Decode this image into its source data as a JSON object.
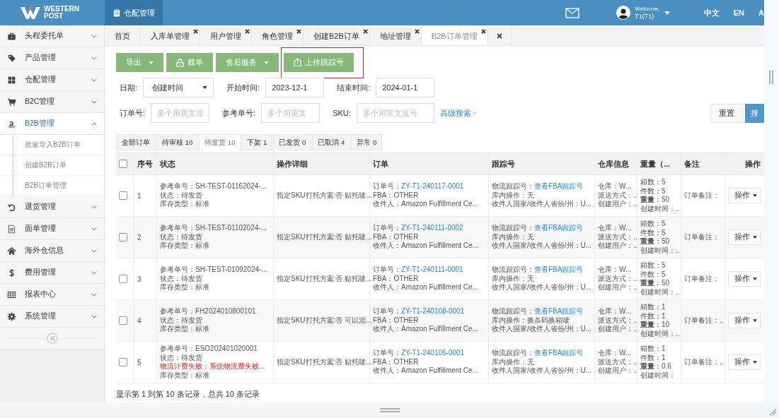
{
  "header": {
    "logo_lines": [
      "WESTERN",
      "POST"
    ],
    "module": "仓配管理",
    "welcome": "Welcome,",
    "user": "T1(T1)",
    "languages": [
      "中文",
      "EN",
      "A"
    ]
  },
  "sidebar": {
    "items": [
      {
        "label": "头程委托单",
        "kind": "briefcase",
        "selected": false,
        "expanded": false
      },
      {
        "label": "产品管理",
        "kind": "tag",
        "selected": false,
        "expanded": false
      },
      {
        "label": "仓配管理",
        "kind": "grid",
        "selected": false,
        "expanded": false
      },
      {
        "label": "B2C管理",
        "kind": "cart",
        "selected": false,
        "expanded": false
      },
      {
        "label": "B2B管理",
        "kind": "smile",
        "selected": true,
        "expanded": true,
        "children": [
          {
            "label": "批量导入B2B订单",
            "selected": false
          },
          {
            "label": "创建B2B订单",
            "selected": false
          },
          {
            "label": "B2B订单管理",
            "selected": false
          }
        ]
      },
      {
        "label": "退货管理",
        "kind": "undo",
        "selected": false,
        "expanded": false
      },
      {
        "label": "面单管理",
        "kind": "doc",
        "selected": false,
        "expanded": false
      },
      {
        "label": "海外仓信息",
        "kind": "home",
        "selected": false,
        "expanded": false
      },
      {
        "label": "费用管理",
        "kind": "dollar",
        "selected": false,
        "expanded": false
      },
      {
        "label": "报表中心",
        "kind": "table",
        "selected": false,
        "expanded": false
      },
      {
        "label": "系统管理",
        "kind": "gear",
        "selected": false,
        "expanded": false
      }
    ]
  },
  "tabs": [
    {
      "label": "首页",
      "closable": false,
      "selected": false
    },
    {
      "label": "入库单管理",
      "closable": true,
      "selected": false
    },
    {
      "label": "用户管理",
      "closable": true,
      "selected": false
    },
    {
      "label": "角色管理",
      "closable": true,
      "selected": false
    },
    {
      "label": "创建B2B订单",
      "closable": true,
      "selected": false
    },
    {
      "label": "地址管理",
      "closable": true,
      "selected": false
    },
    {
      "label": "B2B订单管理",
      "closable": true,
      "selected": true
    }
  ],
  "toolbar": [
    {
      "label": "导出",
      "kind": "dropdown",
      "highlighted": false
    },
    {
      "label": "截单",
      "kind": "lock",
      "highlighted": false
    },
    {
      "label": "售后服务",
      "kind": "dropdown",
      "highlighted": false
    },
    {
      "label": "上传跟踪号",
      "kind": "upload",
      "highlighted": true
    }
  ],
  "filters": {
    "row1": [
      {
        "label": "日期:",
        "kind": "select",
        "value": "创建时间"
      },
      {
        "label": "开始时间:",
        "kind": "input",
        "value": "2023-12-1"
      },
      {
        "label": "结束时间:",
        "kind": "input",
        "value": "2024-01-1"
      }
    ],
    "row2": [
      {
        "label": "订单号:",
        "kind": "input",
        "placeholder": "多个用英文逗"
      },
      {
        "label": "参考单号:",
        "kind": "input",
        "placeholder": "多个用英文"
      },
      {
        "label": "SKU:",
        "kind": "input",
        "placeholder": "多个用英文逗号"
      }
    ],
    "advanced": "高级搜索",
    "reset": "重置",
    "search": "搜"
  },
  "status_tabs": [
    {
      "label": "全部订单",
      "selected": false
    },
    {
      "label": "待审核 10",
      "selected": false
    },
    {
      "label": "待发货 10",
      "selected": true
    },
    {
      "label": "下架 1",
      "selected": false
    },
    {
      "label": "已发货 0",
      "selected": false
    },
    {
      "label": "已取消 4",
      "selected": false
    },
    {
      "label": "异常 0",
      "selected": false
    }
  ],
  "table": {
    "all_checked": false,
    "columns": [
      "序号",
      "状态",
      "操作详细",
      "订单",
      "跟踪号",
      "仓库信息",
      "重量（...",
      "备注",
      "操作"
    ],
    "rows": [
      {
        "checked": false,
        "index": "1",
        "status": [
          {
            "text": "参考单号：SH-TEST-01162024-...",
            "kind": "text"
          },
          {
            "text": "状态：待发货",
            "kind": "text"
          },
          {
            "text": "库存类型：标准",
            "kind": "text"
          }
        ],
        "detail": "指定SKU打托方案:否 贴托唛...",
        "order_label": "订单号：",
        "order_no": "ZY-T1-240117-0001",
        "order_lines": [
          "FBA：OTHER",
          "收件人：Amazon Fulfillment Ce..."
        ],
        "track_label": "物流跟踪号：",
        "track_link": "查看FBA跟踪号",
        "track_lines": [
          "库内操作：无",
          "收件人国家/收件人省份/州：U..."
        ],
        "warehouse": [
          "仓库：W...",
          "派送方式：..",
          "创建用户：.."
        ],
        "weight": [
          "箱数：5",
          "件数：5",
          "**重量**：50",
          "创建时间：.."
        ],
        "remark": "订单备注：",
        "action": "操作"
      },
      {
        "checked": false,
        "index": "2",
        "status": [
          {
            "text": "参考单号：SH-TEST-01102024-...",
            "kind": "text"
          },
          {
            "text": "状态：待发货",
            "kind": "text"
          },
          {
            "text": "库存类型：标准",
            "kind": "text"
          }
        ],
        "detail": "指定SKU打托方案:否 贴托唛...",
        "order_label": "订单号：",
        "order_no": "ZY-T1-240111-0002",
        "order_lines": [
          "FBA：OTHER",
          "收件人：Amazon Fulfillment Ce..."
        ],
        "track_label": "物流跟踪号：",
        "track_link": "查看FBA跟踪号",
        "track_lines": [
          "库内操作：无",
          "收件人国家/收件人省份/州：U..."
        ],
        "warehouse": [
          "仓库：W...",
          "派送方式：..",
          "创建用户：.."
        ],
        "weight": [
          "箱数：5",
          "件数：5",
          "**重量**：50",
          "创建时间：.."
        ],
        "remark": "订单备注：",
        "action": "操作"
      },
      {
        "checked": false,
        "index": "3",
        "status": [
          {
            "text": "参考单号：SH-TEST-01092024-...",
            "kind": "text"
          },
          {
            "text": "状态：待发货",
            "kind": "text"
          },
          {
            "text": "库存类型：标准",
            "kind": "text"
          }
        ],
        "detail": "指定SKU打托方案:否 贴托唛...",
        "order_label": "订单号：",
        "order_no": "ZY-T1-240111-0001",
        "order_lines": [
          "FBA：OTHER",
          "收件人：Amazon Fulfillment Ce..."
        ],
        "track_label": "物流跟踪号：",
        "track_link": "查看FBA跟踪号",
        "track_lines": [
          "库内操作：无",
          "收件人国家/收件人省份/州：U..."
        ],
        "warehouse": [
          "仓库：W...",
          "派送方式：..",
          "创建用户：.."
        ],
        "weight": [
          "箱数：5",
          "件数：5",
          "**重量**：50",
          "创建时间：.."
        ],
        "remark": "订单备注：",
        "action": "操作"
      },
      {
        "checked": false,
        "index": "4",
        "status": [
          {
            "text": "参考单号：FH2024010800101",
            "kind": "text"
          },
          {
            "text": "状态：待发货",
            "kind": "text"
          },
          {
            "text": "库存类型：标准",
            "kind": "text"
          }
        ],
        "detail": "指定SKU打托方案:否 可以混...",
        "order_label": "订单号：",
        "order_no": "ZY-T1-240108-0001",
        "order_lines": [
          "FBA：OTHER",
          "收件人：Amazon Fulfillment Ce..."
        ],
        "track_label": "物流跟踪号：",
        "track_link": "查看FBA跟踪号",
        "track_lines": [
          "库内操作：换条码换箱唛",
          "收件人国家/收件人省份/州：U..."
        ],
        "warehouse": [
          "仓库：W...",
          "派送方式：..",
          "创建用户：.."
        ],
        "weight": [
          "箱数：1",
          "件数：1",
          "**重量**：10",
          "创建时间：.."
        ],
        "remark": "订单备注：..",
        "action": "操作"
      },
      {
        "checked": false,
        "index": "5",
        "status": [
          {
            "text": "参考单号：ESO202401020001",
            "kind": "text"
          },
          {
            "text": "状态：待发货",
            "kind": "text"
          },
          {
            "text": "物流计费失败：系统物流费失败...",
            "kind": "error"
          },
          {
            "text": "库存类型：标准",
            "kind": "text"
          }
        ],
        "detail": "指定SKU打托方案:否 贴托唛...",
        "order_label": "订单号：",
        "order_no": "ZY-T1-240105-0001",
        "order_lines": [
          "FBA：OTHER",
          "收件人：Amazon Fulfillment Ce..."
        ],
        "track_label": "物流跟踪号：",
        "track_link": "查看FBA跟踪号",
        "track_lines": [
          "库内操作：无",
          "收件人国家/收件人省份/州：U..."
        ],
        "warehouse": [
          "仓库：W...",
          "派送方式：..",
          "创建用户：.."
        ],
        "weight": [
          "箱数：1",
          "件数：1",
          "**重量**：0.6",
          "创建时间："
        ],
        "remark": "订单备注：..",
        "action": "操作"
      }
    ]
  },
  "footer": "显示第 1 到第 10 条记录，总共 10 条记录"
}
